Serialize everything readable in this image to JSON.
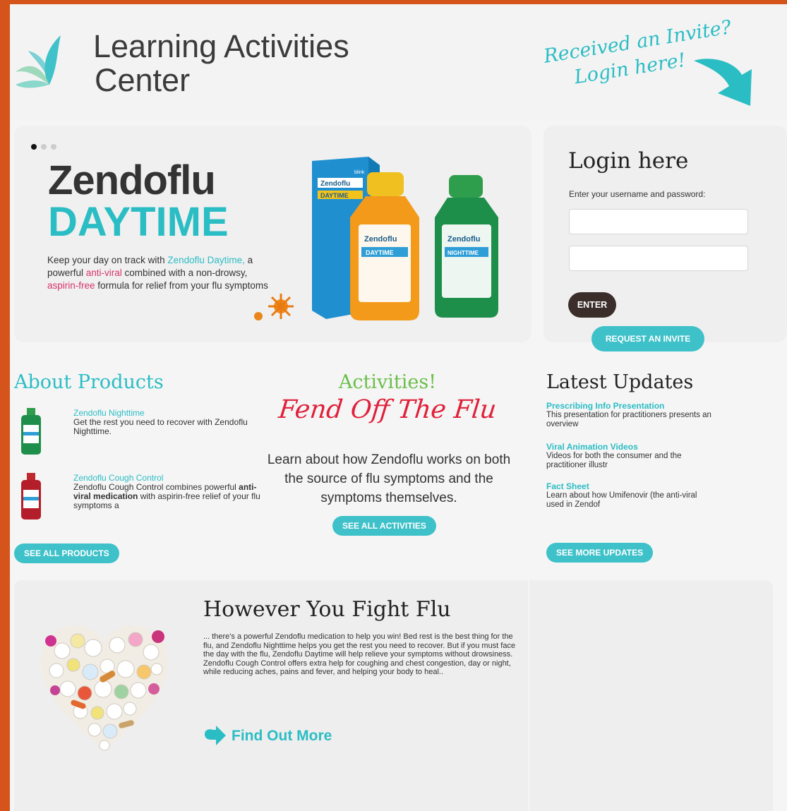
{
  "header": {
    "brand_line1": "Learning Activities",
    "brand_line2": "Center",
    "invite_line1": "Received an Invite?",
    "invite_line2": "Login here!"
  },
  "hero": {
    "title": "Zendoflu",
    "subtitle": "DAYTIME",
    "desc_part1": "Keep your day on track with ",
    "desc_highlight1": "Zendoflu Daytime,",
    "desc_part2": " a powerful ",
    "desc_highlight2": "anti-viral",
    "desc_part3": " combined with a non-drowsy, ",
    "desc_highlight3": "aspirin-free",
    "desc_part4": " formula for relief from your flu symptoms",
    "slides": 3,
    "active_slide": 1
  },
  "login": {
    "title": "Login here",
    "hint": "Enter your username and password:",
    "enter_label": "ENTER",
    "request_label": "REQUEST AN INVITE"
  },
  "about": {
    "title": "About Products",
    "items": [
      {
        "name": "Zendoflu Nighttime",
        "desc": "Get the rest you need to recover with Zendoflu Nighttime."
      },
      {
        "name": "Zendoflu Cough Control",
        "desc_part1": "Zendoflu Cough Control combines powerful ",
        "desc_bold": "anti-viral medication",
        "desc_part2": " with aspirin-free relief of your flu symptoms a"
      }
    ],
    "button": "SEE ALL PRODUCTS"
  },
  "activities": {
    "title": "Activities!",
    "subtitle": "Fend Off The Flu",
    "desc": "Learn about how Zendoflu works on both the source of flu symptoms and the symptoms themselves.",
    "button": "SEE ALL ACTIVITIES"
  },
  "updates": {
    "title": "Latest Updates",
    "items": [
      {
        "title": "Prescribing Info Presentation",
        "desc": "This presentation for practitioners presents an overview"
      },
      {
        "title": "Viral Animation Videos",
        "desc": "Videos for both the consumer and the practitioner illustr"
      },
      {
        "title": "Fact Sheet",
        "desc": "Learn about how Umifenovir (the anti-viral used in Zendof"
      }
    ],
    "button": "SEE MORE UPDATES"
  },
  "fight": {
    "title": "However You Fight Flu",
    "text": "... there's a powerful Zendoflu medication to help you win! Bed rest is the best thing for the flu, and Zendoflu Nighttime helps you get the rest you need to recover. But if you must face the day with the flu, Zendoflu Daytime will help relieve your symptoms without drowsiness. Zendoflu Cough Control offers extra help for coughing and chest congestion, day or night, while reducing aches, pains and fever, and helping your body to heal..",
    "link": "Find Out More"
  },
  "product_label": {
    "brand": "Zendoflu",
    "variant_day": "DAYTIME",
    "variant_night": "NIGHTTIME",
    "maker": "blink"
  },
  "colors": {
    "accent": "#2bbdc4",
    "pink": "#d6336c",
    "red": "#e0203a",
    "frame": "#d4541c"
  }
}
